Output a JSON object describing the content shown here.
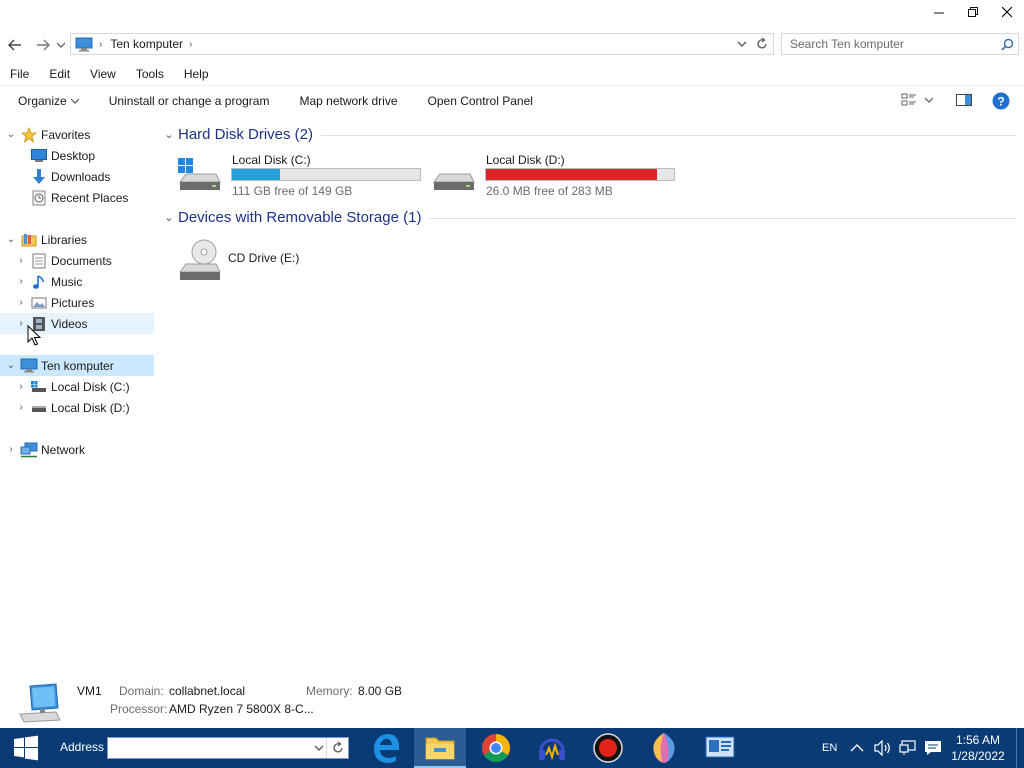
{
  "window": {
    "location": "Ten komputer",
    "search_placeholder": "Search Ten komputer"
  },
  "menu": [
    "File",
    "Edit",
    "View",
    "Tools",
    "Help"
  ],
  "commands": {
    "organize": "Organize",
    "uninstall": "Uninstall or change a program",
    "map_drive": "Map network drive",
    "control_panel": "Open Control Panel"
  },
  "nav": {
    "favorites": "Favorites",
    "desktop": "Desktop",
    "downloads": "Downloads",
    "recent": "Recent Places",
    "libraries": "Libraries",
    "documents": "Documents",
    "music": "Music",
    "pictures": "Pictures",
    "videos": "Videos",
    "this_pc": "Ten komputer",
    "disk_c": "Local Disk (C:)",
    "disk_d": "Local Disk (D:)",
    "network": "Network"
  },
  "groups": {
    "hdd": "Hard Disk Drives (2)",
    "removable": "Devices with Removable Storage (1)"
  },
  "drives": [
    {
      "name": "Local Disk (C:)",
      "free": "111 GB free of 149 GB",
      "used_fraction": 0.255,
      "color": "#26a0da"
    },
    {
      "name": "Local Disk (D:)",
      "free": "26.0 MB free of 283 MB",
      "used_fraction": 0.908,
      "color": "#da2626"
    }
  ],
  "cd_drive": "CD Drive (E:)",
  "details": {
    "name": "VM1",
    "domain_label": "Domain:",
    "domain": "collabnet.local",
    "memory_label": "Memory:",
    "memory": "8.00 GB",
    "processor_label": "Processor:",
    "processor": "AMD Ryzen 7 5800X 8-C..."
  },
  "taskbar": {
    "address_label": "Address",
    "lang": "EN",
    "time": "1:56 AM",
    "date": "1/28/2022"
  }
}
